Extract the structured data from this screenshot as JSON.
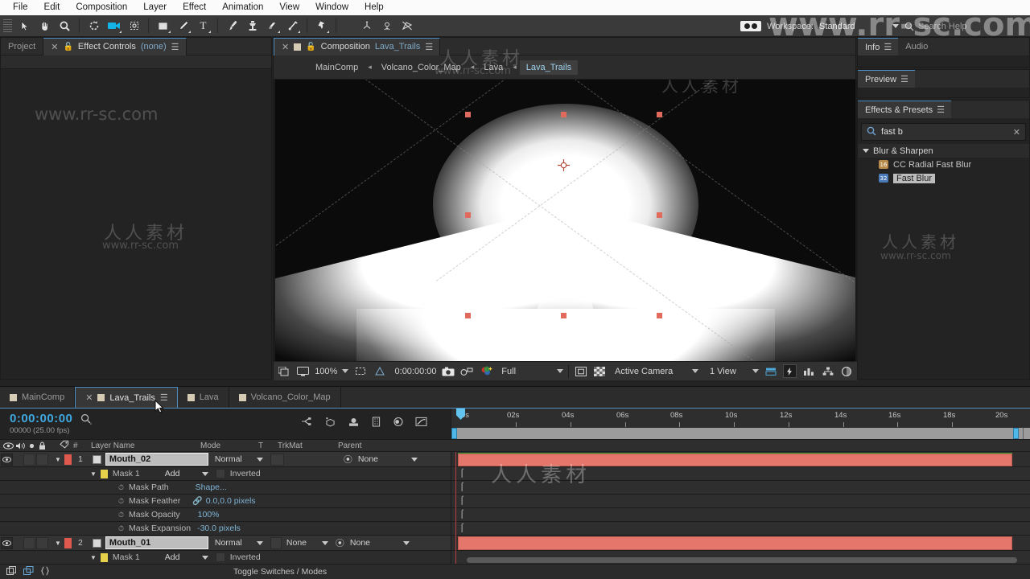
{
  "menu": {
    "items": [
      "File",
      "Edit",
      "Composition",
      "Layer",
      "Effect",
      "Animation",
      "View",
      "Window",
      "Help"
    ]
  },
  "toolbar": {
    "tools": [
      "selection-tool",
      "hand-tool",
      "zoom-tool",
      "rotation-tool",
      "camera-tool",
      "pan-behind-tool",
      "shape-tool",
      "pen-tool",
      "text-tool",
      "brush-tool",
      "clone-stamp-tool",
      "eraser-tool",
      "roto-brush-tool",
      "puppet-pin-tool"
    ],
    "axis_tools": [
      "local-axis-mode",
      "world-axis-mode",
      "view-axis-mode"
    ],
    "workspace_label": "Workspace:",
    "workspace_value": "Standard",
    "search_placeholder": "Search Help"
  },
  "watermark": {
    "big": "www.rr-sc.com",
    "cn": "人人素材",
    "url": "www.rr-sc.com"
  },
  "left_panel": {
    "tabs": [
      {
        "label": "Project",
        "active": false
      },
      {
        "label": "Effect Controls",
        "suffix": "(none)",
        "active": true
      }
    ]
  },
  "composition": {
    "tab_title": "Composition",
    "tab_name": "Lava_Trails",
    "breadcrumb": [
      "MainComp",
      "Volcano_Color_Map",
      "Lava",
      "Lava_Trails"
    ],
    "breadcrumb_current": "Lava_Trails",
    "viewer_bar": {
      "magnification": "100%",
      "timecode": "0:00:00:00",
      "resolution": "Full",
      "view_camera": "Active Camera",
      "view_layout": "1 View"
    }
  },
  "right": {
    "info_tab": "Info",
    "audio_tab": "Audio",
    "preview_tab": "Preview",
    "effects_tab": "Effects & Presets",
    "search_value": "fast b",
    "search_placeholder": "Search",
    "categories": [
      {
        "name": "Blur & Sharpen",
        "effects": [
          {
            "name": "CC Radial Fast Blur",
            "bits": "16",
            "selected": false
          },
          {
            "name": "Fast Blur",
            "bits": "32",
            "selected": true
          }
        ]
      }
    ]
  },
  "timeline": {
    "tabs": [
      {
        "label": "MainComp",
        "active": false
      },
      {
        "label": "Lava_Trails",
        "active": true
      },
      {
        "label": "Lava",
        "active": false
      },
      {
        "label": "Volcano_Color_Map",
        "active": false
      }
    ],
    "current_time": "0:00:00:00",
    "frame_info": "00000 (25.00 fps)",
    "columns": [
      "#",
      "Layer Name",
      "Mode",
      "T",
      "TrkMat",
      "Parent"
    ],
    "ruler_ticks": [
      "0s",
      "02s",
      "04s",
      "06s",
      "08s",
      "10s",
      "12s",
      "14s",
      "16s",
      "18s",
      "20s"
    ],
    "footer_label": "Toggle Switches / Modes",
    "layers": [
      {
        "index": "1",
        "name": "Mouth_02",
        "editing": true,
        "mode": "Normal",
        "trkmat": "",
        "parent": "None",
        "color": "#e0594f",
        "mask": {
          "name": "Mask 1",
          "mode": "Add",
          "inverted": "Inverted",
          "properties": [
            {
              "label": "Mask Path",
              "value": "Shape...",
              "link": false
            },
            {
              "label": "Mask Feather",
              "value": "0.0,0.0  pixels",
              "link": true
            },
            {
              "label": "Mask Opacity",
              "value": "100%",
              "link": false
            },
            {
              "label": "Mask Expansion",
              "value": "-30.0  pixels",
              "link": false
            }
          ]
        }
      },
      {
        "index": "2",
        "name": "Mouth_01",
        "editing": true,
        "mode": "Normal",
        "trkmat": "None",
        "parent": "None",
        "color": "#e0594f",
        "mask": {
          "name": "Mask 1",
          "mode": "Add",
          "inverted": "Inverted",
          "properties": []
        }
      }
    ]
  },
  "colors": {
    "accent_blue": "#4d8fc4",
    "layer_red": "#e5766c",
    "work_green": "#2fa02f",
    "time_blue": "#3fa9e0"
  }
}
